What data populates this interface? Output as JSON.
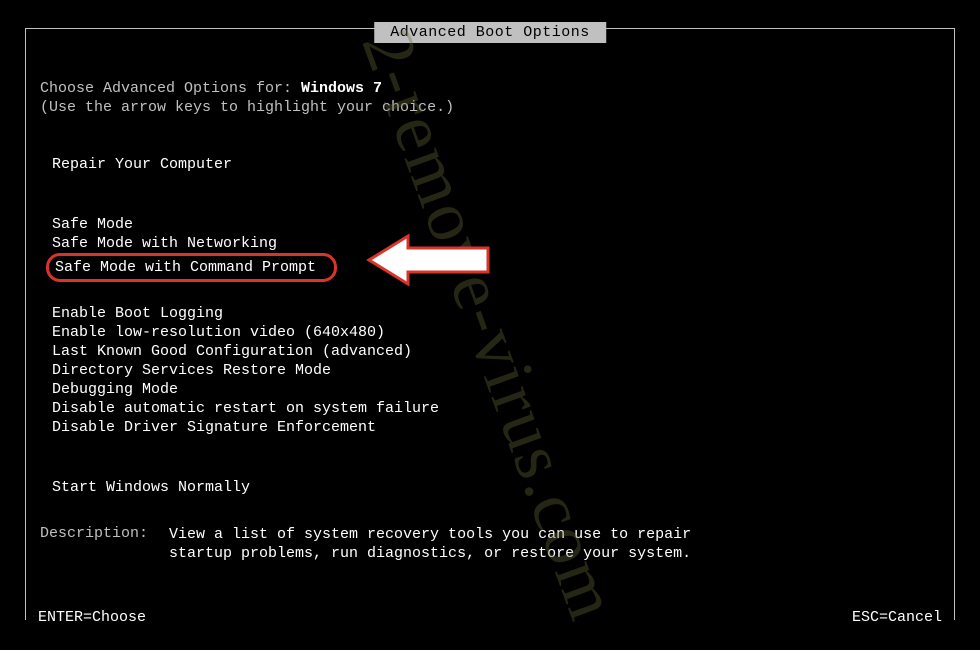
{
  "title": "Advanced Boot Options",
  "choose_prefix": "Choose Advanced Options for: ",
  "os_name": "Windows 7",
  "hint": "(Use the arrow keys to highlight your choice.)",
  "repair_label": "Repair Your Computer",
  "options_group1": [
    "Safe Mode",
    "Safe Mode with Networking",
    "Safe Mode with Command Prompt"
  ],
  "options_group2": [
    "Enable Boot Logging",
    "Enable low-resolution video (640x480)",
    "Last Known Good Configuration (advanced)",
    "Directory Services Restore Mode",
    "Debugging Mode",
    "Disable automatic restart on system failure",
    "Disable Driver Signature Enforcement"
  ],
  "start_normal": "Start Windows Normally",
  "highlighted_index": 2,
  "description_label": "Description:",
  "description_text": "View a list of system recovery tools you can use to repair startup problems, run diagnostics, or restore your system.",
  "footer_left": "ENTER=Choose",
  "footer_right": "ESC=Cancel",
  "watermark": "2-remove-virus.com",
  "annotation": {
    "arrow_color": "#ffffff",
    "arrow_stroke": "#d9342a"
  }
}
